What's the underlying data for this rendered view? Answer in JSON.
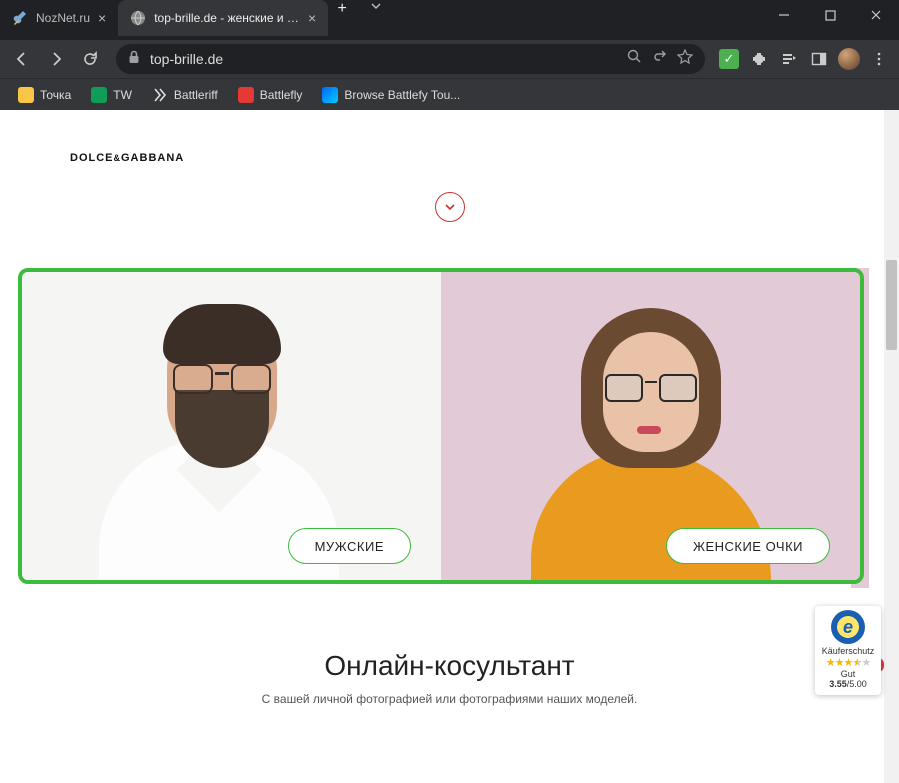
{
  "titlebar": {
    "tabs": [
      {
        "title": "NozNet.ru",
        "active": false
      },
      {
        "title": "top-brille.de - женские и мужск",
        "active": true
      }
    ]
  },
  "toolbar": {
    "url": "top-brille.de"
  },
  "bookmarks": [
    {
      "label": "Точка"
    },
    {
      "label": "TW"
    },
    {
      "label": "Battleriff"
    },
    {
      "label": "Battlefly"
    },
    {
      "label": "Browse Battlefy Tou..."
    }
  ],
  "page": {
    "brand_prefix": "DOLCE",
    "brand_amp": "&",
    "brand_suffix": "GABBANA",
    "cta_men": "МУЖСКИЕ",
    "cta_women": "ЖЕНСКИЕ ОЧКИ",
    "consult_heading": "Онлайн-косультант",
    "consult_sub": "С вашей личной фотографией или фотографиями наших моделей."
  },
  "trust": {
    "label": "Käuferschutz",
    "grade": "Gut",
    "score": "3.55",
    "score_sep": "/",
    "score_max": "5.00"
  }
}
